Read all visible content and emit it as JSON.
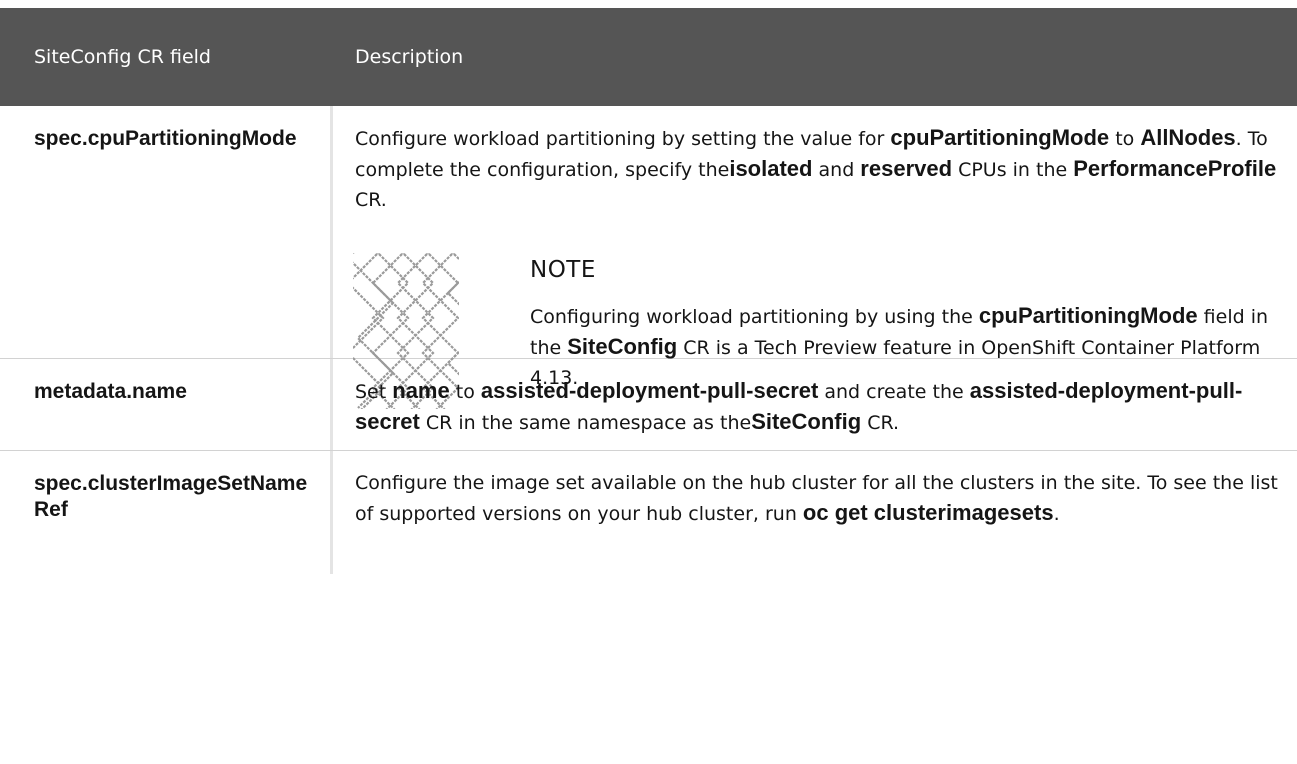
{
  "header": {
    "col_field": "SiteConfig CR field",
    "col_description": "Description"
  },
  "rows": [
    {
      "field": "spec.cpuPartitioningMode",
      "desc": {
        "t1": "Configure workload partitioning by setting the value for ",
        "b1": "cpuPartitioningMode",
        "t2": " to ",
        "b2": "AllNodes",
        "t3": ". To complete the configuration, specify the",
        "b3": "isolated",
        "t4": " and ",
        "b4": "reserved",
        "t5": " CPUs in the ",
        "b5": "PerformanceProfile",
        "t6": " CR."
      },
      "note": {
        "icon": "note-pattern-icon",
        "title": "NOTE",
        "t1": "Configuring workload partitioning by using the ",
        "b1": "cpuPartitioningMode",
        "t2": " field in the ",
        "b2": "SiteConfig",
        "t3": " CR is a Tech Preview feature in OpenShift Container Platform 4.13."
      }
    },
    {
      "field": "metadata.name",
      "desc": {
        "t1": "Set ",
        "b1": "name",
        "t2": " to ",
        "b2": "assisted-deployment-pull-secret",
        "t3": " and create the ",
        "b3": "assisted-deployment-pull-secret",
        "t4": " CR in the same namespace as the",
        "b4": "SiteConfig",
        "t5": " CR."
      }
    },
    {
      "field": "spec.clusterImageSetNameRef",
      "desc": {
        "t1": "Configure the image set available on the hub cluster for all the clusters in the site. To see the list of supported versions on your hub cluster, run ",
        "b1": "oc get clusterimagesets",
        "t2": "."
      }
    }
  ]
}
